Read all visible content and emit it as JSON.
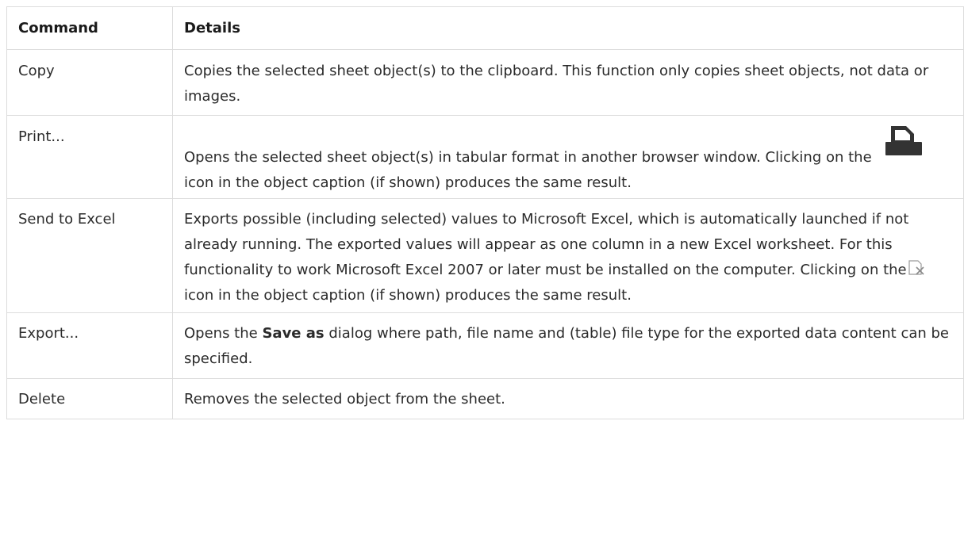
{
  "table": {
    "headers": {
      "command": "Command",
      "details": "Details"
    },
    "rows": {
      "copy": {
        "command": "Copy",
        "details": "Copies the selected sheet object(s) to the clipboard. This function only copies sheet objects, not data or images."
      },
      "print": {
        "command": "Print...",
        "details_a": "Opens the selected sheet object(s) in tabular format in another browser window. Clicking on the",
        "icon": "print-icon",
        "details_b": "icon in the object caption (if shown) produces the same result."
      },
      "send": {
        "command": "Send to Excel",
        "details_a": "Exports possible (including selected) values to Microsoft Excel, which is automatically launched if not already running. The exported values will appear as one column in a new Excel worksheet. For this functionality to work Microsoft Excel 2007 or later must be installed on the computer. Clicking on the",
        "icon": "excel-icon",
        "details_b": "icon in the object caption (if shown) produces the same result."
      },
      "export": {
        "command": "Export...",
        "details_a": "Opens the",
        "details_bold": "Save as",
        "details_b": "dialog where path, file name and (table) file type for the exported data content can be specified."
      },
      "delete": {
        "command": "Delete",
        "details": "Removes the selected object from the sheet."
      }
    }
  }
}
